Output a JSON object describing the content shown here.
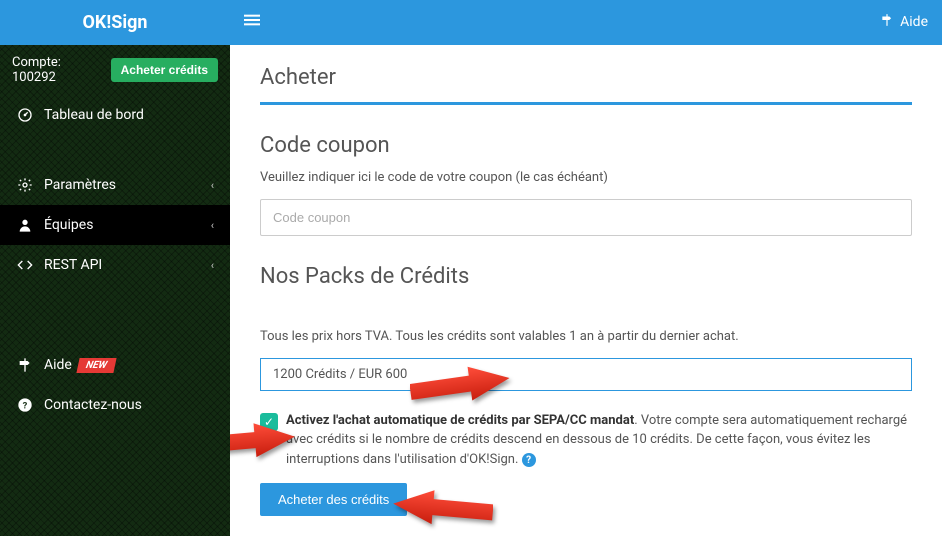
{
  "brand": "OK!Sign",
  "account": {
    "label": "Compte: 100292",
    "buy_label": "Acheter crédits"
  },
  "nav": {
    "dashboard": "Tableau de bord",
    "params": "Paramètres",
    "teams": "Équipes",
    "rest": "REST API",
    "help": "Aide",
    "help_badge": "NEW",
    "contact": "Contactez-nous"
  },
  "topbar": {
    "help": "Aide"
  },
  "page": {
    "title": "Acheter",
    "coupon_heading": "Code coupon",
    "coupon_help": "Veuillez indiquer ici le code de votre coupon (le cas échéant)",
    "coupon_placeholder": "Code coupon",
    "packs_heading": "Nos Packs de Crédits",
    "tva_note": "Tous les prix hors TVA. Tous les crédits sont valables 1 an à partir du dernier achat.",
    "pack_selected": "1200 Crédits /  EUR 600",
    "auto_strong": "Activez l'achat automatique de crédits par SEPA/CC mandat",
    "auto_text": ". Votre compte sera automatiquement rechargé avec crédits si le nombre de crédits descend en dessous de 10 crédits. De cette façon, vous évitez les interruptions dans l'utilisation d'OK!Sign. ",
    "buy_button": "Acheter des crédits"
  }
}
